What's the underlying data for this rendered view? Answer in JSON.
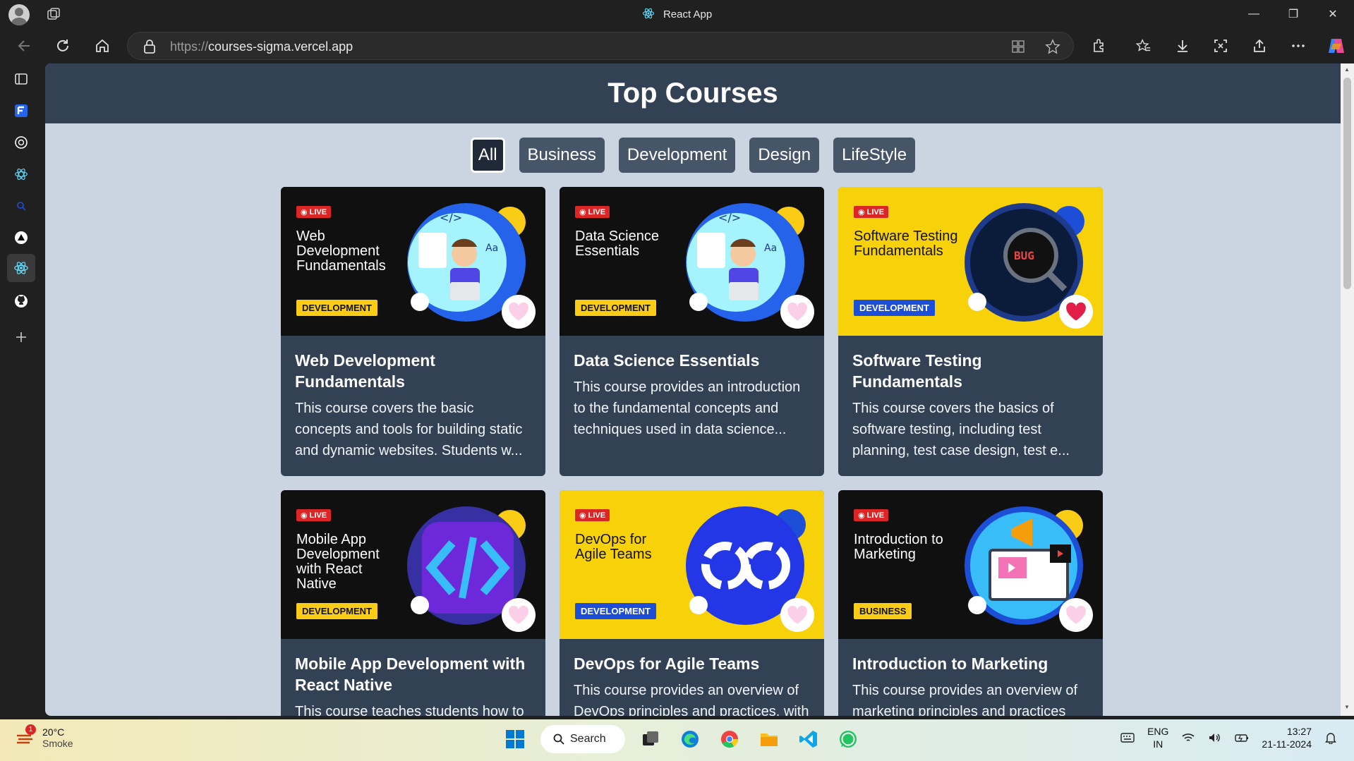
{
  "browser": {
    "tab_title": "React App",
    "url_scheme": "https://",
    "url_host": "courses-sigma.vercel.app"
  },
  "page": {
    "title": "Top Courses",
    "filters": [
      {
        "label": "All",
        "active": true
      },
      {
        "label": "Business",
        "active": false
      },
      {
        "label": "Development",
        "active": false
      },
      {
        "label": "Design",
        "active": false
      },
      {
        "label": "LifeStyle",
        "active": false
      }
    ],
    "live_label": "LIVE",
    "courses": [
      {
        "thumb_title": "Web Development Fundamentals",
        "tag": "DEVELOPMENT",
        "title": "Web Development Fundamentals",
        "description": "This course covers the basic concepts and tools for building static and dynamic websites. Students w...",
        "liked": false
      },
      {
        "thumb_title": "Data Science Essentials",
        "tag": "DEVELOPMENT",
        "title": "Data Science Essentials",
        "description": "This course provides an introduction to the fundamental concepts and techniques used in data science...",
        "liked": false
      },
      {
        "thumb_title": "Software Testing Fundamentals",
        "tag": "DEVELOPMENT",
        "title": "Software Testing Fundamentals",
        "description": "This course covers the basics of software testing, including test planning, test case design, test e...",
        "liked": true
      },
      {
        "thumb_title": "Mobile App Development with React Native",
        "tag": "DEVELOPMENT",
        "title": "Mobile App Development with React Native",
        "description": "This course teaches students how to",
        "liked": false
      },
      {
        "thumb_title": "DevOps for Agile Teams",
        "tag": "DEVELOPMENT",
        "title": "DevOps for Agile Teams",
        "description": "This course provides an overview of DevOps principles and practices, with",
        "liked": false
      },
      {
        "thumb_title": "Introduction to Marketing",
        "tag": "BUSINESS",
        "title": "Introduction to Marketing",
        "description": "This course provides an overview of marketing principles and practices",
        "liked": false
      }
    ]
  },
  "taskbar": {
    "weather_temp": "20°C",
    "weather_cond": "Smoke",
    "weather_badge": "1",
    "search_label": "Search",
    "lang_top": "ENG",
    "lang_bottom": "IN",
    "time": "13:27",
    "date": "21-11-2024"
  },
  "colors": {
    "page_bg": "#cbd5e1",
    "header_bg": "#334155",
    "card_bg": "#334155",
    "thumb_yellow": "#f7d10a",
    "heart_red": "#e11d48"
  }
}
